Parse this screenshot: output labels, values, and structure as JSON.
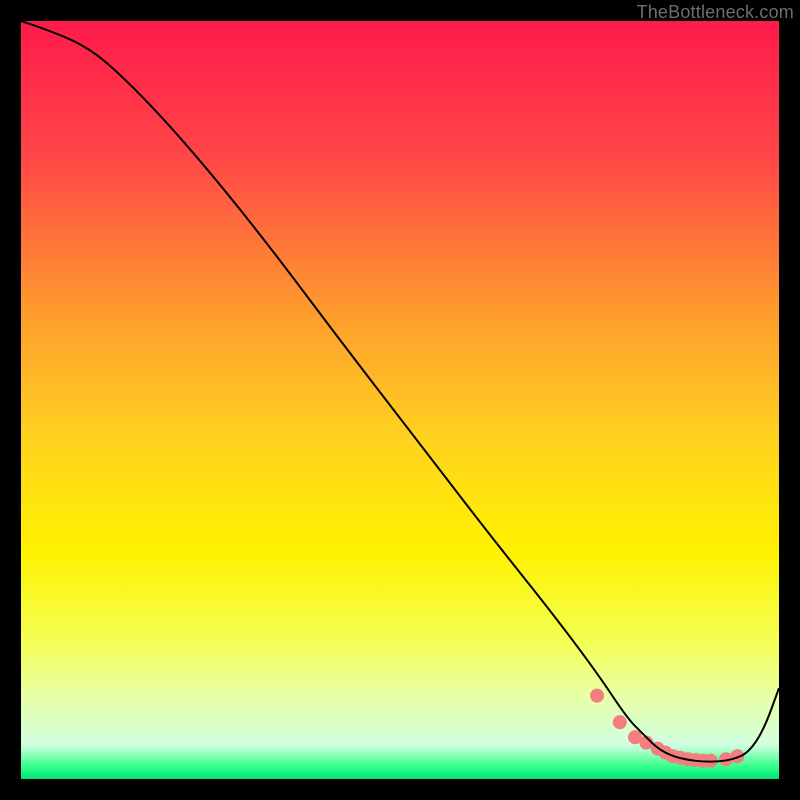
{
  "watermark": "TheBottleneck.com",
  "chart_data": {
    "type": "line",
    "title": "",
    "xlabel": "",
    "ylabel": "",
    "xlim": [
      0,
      100
    ],
    "ylim": [
      0,
      100
    ],
    "grid": false,
    "background_gradient": {
      "stops": [
        {
          "offset": 0.0,
          "color": "#ff1a4b"
        },
        {
          "offset": 0.18,
          "color": "#ff4747"
        },
        {
          "offset": 0.38,
          "color": "#ff9a2e"
        },
        {
          "offset": 0.55,
          "color": "#ffd21f"
        },
        {
          "offset": 0.7,
          "color": "#fff200"
        },
        {
          "offset": 0.82,
          "color": "#f3ff55"
        },
        {
          "offset": 0.9,
          "color": "#e6ffb0"
        },
        {
          "offset": 0.955,
          "color": "#d2ffe0"
        },
        {
          "offset": 0.985,
          "color": "#2dff86"
        },
        {
          "offset": 1.0,
          "color": "#00e07a"
        }
      ]
    },
    "series": [
      {
        "name": "bottleneck-curve",
        "color": "#000000",
        "width": 2,
        "x": [
          0,
          3,
          8,
          12,
          18,
          25,
          33,
          42,
          52,
          62,
          70,
          76,
          80,
          82,
          84,
          86,
          88,
          90,
          92,
          94,
          96,
          98,
          100
        ],
        "y": [
          100,
          99,
          97,
          94,
          88,
          80,
          70,
          58,
          45,
          32,
          22,
          14,
          8,
          6,
          4,
          3,
          2.5,
          2.3,
          2.3,
          2.6,
          3.5,
          6.5,
          12
        ]
      }
    ],
    "markers": {
      "name": "optimal-range",
      "color": "#f47d7d",
      "radius": 7,
      "x": [
        76,
        79,
        81,
        82.5,
        84,
        85,
        86,
        87,
        88,
        89,
        90,
        91,
        93,
        94.5
      ],
      "y": [
        11,
        7.5,
        5.5,
        4.8,
        4,
        3.5,
        3,
        2.8,
        2.6,
        2.5,
        2.4,
        2.4,
        2.6,
        3
      ]
    }
  }
}
